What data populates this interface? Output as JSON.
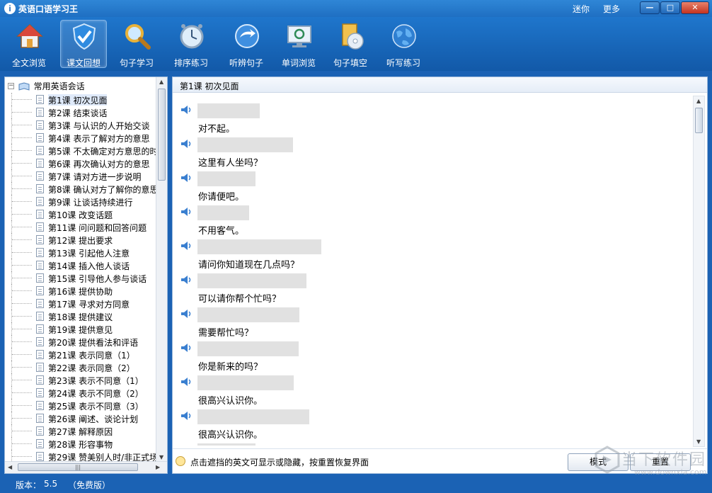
{
  "window": {
    "title": "英语口语学习王",
    "links": {
      "mini": "迷你",
      "more": "更多"
    }
  },
  "toolbar": {
    "items": [
      {
        "label": "全文浏览",
        "icon": "home-icon"
      },
      {
        "label": "课文回想",
        "icon": "shield-check-icon",
        "active": true
      },
      {
        "label": "句子学习",
        "icon": "magnifier-icon"
      },
      {
        "label": "排序练习",
        "icon": "clock-icon"
      },
      {
        "label": "听辨句子",
        "icon": "arrow-circle-icon"
      },
      {
        "label": "单词浏览",
        "icon": "monitor-icon"
      },
      {
        "label": "句子填空",
        "icon": "disc-icon"
      },
      {
        "label": "听写练习",
        "icon": "globe-icon"
      }
    ]
  },
  "tree": {
    "root": "常用英语会话",
    "lessons": [
      "第1课 初次见面",
      "第2课 结束谈话",
      "第3课 与认识的人开始交谈",
      "第4课 表示了解对方的意思",
      "第5课 不太确定对方意思的时",
      "第6课 再次确认对方的意思",
      "第7课 请对方进一步说明",
      "第8课 确认对方了解你的意思",
      "第9课 让谈话持续进行",
      "第10课 改变话题",
      "第11课 问问题和回答问题",
      "第12课 提出要求",
      "第13课 引起他人注意",
      "第14课 插入他人谈话",
      "第15课 引导他人参与谈话",
      "第16课 提供协助",
      "第17课 寻求对方同意",
      "第18课 提供建议",
      "第19课 提供意见",
      "第20课 提供看法和评语",
      "第21课 表示同意（1）",
      "第22课 表示同意（2）",
      "第23课 表示不同意（1）",
      "第24课 表示不同意（2）",
      "第25课 表示不同意（3）",
      "第26课 阐述、谈论计划",
      "第27课 解释原因",
      "第28课 形容事物",
      "第29课 赞美别人时/非正式场"
    ]
  },
  "content": {
    "lesson_title": "第1课 初次见面",
    "sentences": [
      "对不起。",
      "这里有人坐吗？",
      "你请便吧。",
      "不用客气。",
      "请问你知道现在几点吗？",
      "可以请你帮个忙吗？",
      "需要帮忙吗？",
      "你是新来的吗？",
      "很高兴认识你。",
      "很高兴认识你。",
      ""
    ],
    "hint": "点击遮挡的英文可显示或隐藏，按重置恢复界面",
    "mode_button": "模式",
    "reset_button": "重置"
  },
  "watermark": {
    "cn": "当下软件园",
    "en": "www.downxia.com"
  },
  "status": {
    "version_label": "版本：",
    "version": "5.5",
    "edition": "（免费版）"
  },
  "colors": {
    "titlebar": "#1f6fc2",
    "toolbar": "#1259a8",
    "frame": "#1b62b4",
    "mask": "#e1e1e1"
  }
}
